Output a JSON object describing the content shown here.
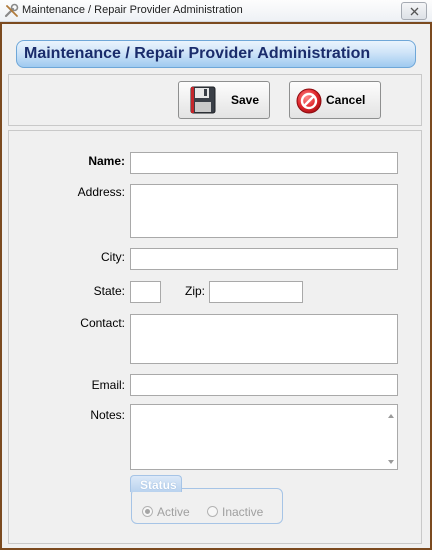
{
  "window": {
    "title": "Maintenance / Repair Provider Administration",
    "icon": "tools-icon",
    "close_icon": "close-icon"
  },
  "header": {
    "title": "Maintenance / Repair Provider Administration"
  },
  "toolbar": {
    "save_label": "Save",
    "save_icon": "floppy-disk-icon",
    "cancel_label": "Cancel",
    "cancel_icon": "cancel-icon"
  },
  "form": {
    "name_label": "Name:",
    "name_value": "",
    "address_label": "Address:",
    "address_value": "",
    "city_label": "City:",
    "city_value": "",
    "state_label": "State:",
    "state_value": "",
    "zip_label": "Zip:",
    "zip_value": "",
    "contact_label": "Contact:",
    "contact_value": "",
    "email_label": "Email:",
    "email_value": "",
    "notes_label": "Notes:",
    "notes_value": ""
  },
  "status": {
    "group_label": "Status",
    "options": [
      {
        "label": "Active",
        "selected": true
      },
      {
        "label": "Inactive",
        "selected": false
      }
    ],
    "enabled": false
  },
  "colors": {
    "frame_border": "#7b4a1f",
    "header_text": "#1a2c6b",
    "header_gradient_bottom": "#9fcaf0",
    "cancel_red": "#d8232a"
  }
}
